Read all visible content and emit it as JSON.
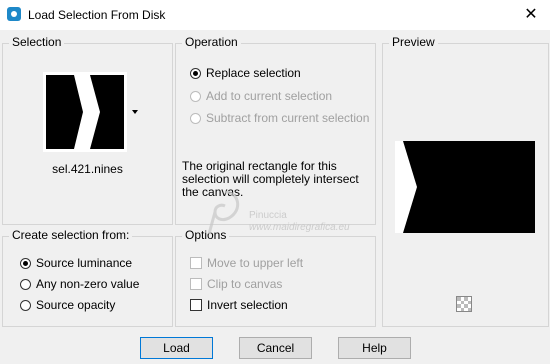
{
  "window": {
    "title": "Load Selection From Disk",
    "close_glyph": "✕"
  },
  "selection": {
    "title": "Selection",
    "filename": "sel.421.nines"
  },
  "operation": {
    "title": "Operation",
    "options": [
      {
        "label": "Replace selection",
        "checked": true,
        "disabled": false
      },
      {
        "label": "Add to current selection",
        "checked": false,
        "disabled": true
      },
      {
        "label": "Subtract from current selection",
        "checked": false,
        "disabled": true
      }
    ],
    "note": "The original rectangle for this selection will completely intersect the canvas."
  },
  "preview": {
    "title": "Preview"
  },
  "create_from": {
    "title": "Create selection from:",
    "options": [
      {
        "label": "Source luminance",
        "checked": true
      },
      {
        "label": "Any non-zero value",
        "checked": false
      },
      {
        "label": "Source opacity",
        "checked": false
      }
    ]
  },
  "options": {
    "title": "Options",
    "items": [
      {
        "label": "Move to upper left",
        "checked": false,
        "disabled": true
      },
      {
        "label": "Clip to canvas",
        "checked": false,
        "disabled": true
      },
      {
        "label": "Invert selection",
        "checked": false,
        "disabled": false
      }
    ]
  },
  "buttons": {
    "load": "Load",
    "cancel": "Cancel",
    "help": "Help"
  },
  "watermark": {
    "line1": "Pinuccia",
    "line2": "www.maidiregrafica.eu"
  },
  "colors": {
    "accent": "#0078d7",
    "window_bg": "#f0f0f0",
    "group_border": "#d5d5d5",
    "disabled_text": "#a0a0a0"
  }
}
